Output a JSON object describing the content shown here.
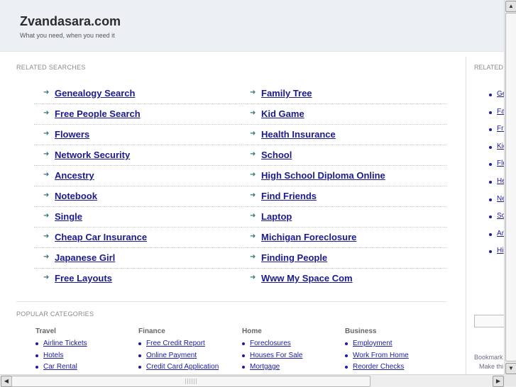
{
  "header": {
    "site_title": "Zvandasara.com",
    "tagline": "What you need, when you need it"
  },
  "related_searches": {
    "title": "RELATED SEARCHES",
    "left": [
      "Genealogy Search",
      "Free People Search",
      "Flowers",
      "Network Security",
      "Ancestry",
      "Notebook",
      "Single",
      "Cheap Car Insurance",
      "Japanese Girl",
      "Free Layouts"
    ],
    "right": [
      "Family Tree",
      "Kid Game",
      "Health Insurance",
      "School",
      "High School Diploma Online",
      "Find Friends",
      "Laptop",
      "Michigan Foreclosure",
      "Finding People",
      "Www My Space Com"
    ]
  },
  "popular_categories": {
    "title": "POPULAR CATEGORIES",
    "columns": [
      {
        "heading": "Travel",
        "items": [
          "Airline Tickets",
          "Hotels",
          "Car Rental"
        ]
      },
      {
        "heading": "Finance",
        "items": [
          "Free Credit Report",
          "Online Payment",
          "Credit Card Application"
        ]
      },
      {
        "heading": "Home",
        "items": [
          "Foreclosures",
          "Houses For Sale",
          "Mortgage"
        ]
      },
      {
        "heading": "Business",
        "items": [
          "Employment",
          "Work From Home",
          "Reorder Checks"
        ]
      }
    ]
  },
  "right_column": {
    "title": "RELATED",
    "items": [
      "Ge",
      "Fa",
      "Fre",
      "Kid",
      "Flo",
      "He",
      "Ne",
      "Sc",
      "Anc",
      "Hig"
    ],
    "bookmark": "Bookmark",
    "make": "Make thi"
  },
  "scrollbars": {
    "up": "▲",
    "down": "▼",
    "left": "◀",
    "right": "▶"
  }
}
